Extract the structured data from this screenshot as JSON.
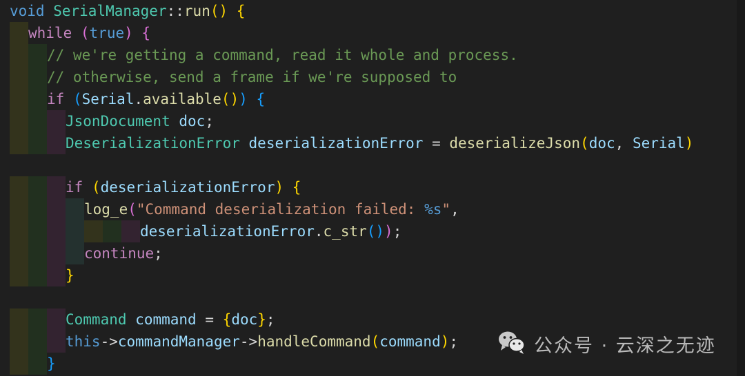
{
  "editor": {
    "background": "#1f1f1f",
    "font_size_px": 21,
    "line_height_px": 32,
    "language": "cpp",
    "indent_colors": [
      "#33331c",
      "#22301f",
      "#332330",
      "#24312f"
    ],
    "theme_colors": {
      "keyword": "#569cd6",
      "control": "#c586c0",
      "type": "#4ec9b0",
      "function": "#dcdcaa",
      "variable": "#9cdcfe",
      "plain": "#d4d4d4",
      "comment": "#6a9955",
      "string": "#ce9178",
      "bracket_level_1": "#ffd700",
      "bracket_level_2": "#da70d6",
      "bracket_level_3": "#179fff"
    }
  },
  "code_lines": [
    {
      "indent": 0,
      "text": "void SerialManager::run() {"
    },
    {
      "indent": 1,
      "text": "while (true) {"
    },
    {
      "indent": 2,
      "text": "// we're getting a command, read it whole and process."
    },
    {
      "indent": 2,
      "text": "// otherwise, send a frame if we're supposed to"
    },
    {
      "indent": 2,
      "text": "if (Serial.available()) {"
    },
    {
      "indent": 3,
      "text": "JsonDocument doc;"
    },
    {
      "indent": 3,
      "text": "DeserializationError deserializationError = deserializeJson(doc, Serial)"
    },
    {
      "indent": 0,
      "text": ""
    },
    {
      "indent": 3,
      "text": "if (deserializationError) {"
    },
    {
      "indent": 4,
      "text": "log_e(\"Command deserialization failed: %s\","
    },
    {
      "indent": 5,
      "text": "deserializationError.c_str());"
    },
    {
      "indent": 4,
      "text": "continue;"
    },
    {
      "indent": 3,
      "text": "}"
    },
    {
      "indent": 0,
      "text": ""
    },
    {
      "indent": 3,
      "text": "Command command = {doc};"
    },
    {
      "indent": 3,
      "text": "this->commandManager->handleCommand(command);"
    },
    {
      "indent": 2,
      "text": "}"
    }
  ],
  "watermark": {
    "icon": "wechat-icon",
    "text": "公众号 · 云深之无迹",
    "color": "#b9b9b9"
  }
}
